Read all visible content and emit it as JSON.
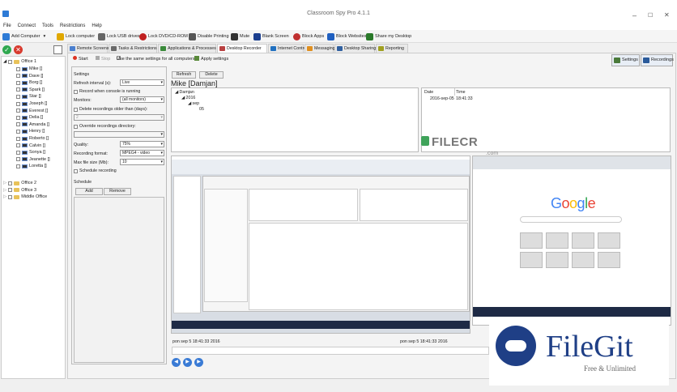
{
  "window": {
    "title": "Classroom Spy Pro 4.1.1",
    "minimize": "–",
    "maximize": "☐",
    "close": "✕"
  },
  "menu": [
    "File",
    "Connect",
    "Tools",
    "Restrictions",
    "Help"
  ],
  "toolbar": [
    {
      "label": "Add Computer",
      "icon": "add-computer-icon",
      "color": "#2e7bd6"
    },
    {
      "label": "Lock computer",
      "icon": "lock-icon",
      "color": "#e0a800"
    },
    {
      "label": "Lock USB drives",
      "icon": "usb-lock-icon",
      "color": "#666"
    },
    {
      "label": "Lock DVD/CD-ROM",
      "icon": "disc-lock-icon",
      "color": "#c02020"
    },
    {
      "label": "Disable Printing",
      "icon": "printer-icon",
      "color": "#555"
    },
    {
      "label": "Mute",
      "icon": "mute-icon",
      "color": "#333"
    },
    {
      "label": "Blank Screen",
      "icon": "blank-screen-icon",
      "color": "#1b3f8f"
    },
    {
      "label": "Block Apps",
      "icon": "block-apps-icon",
      "color": "#c03030"
    },
    {
      "label": "Block Websites",
      "icon": "block-websites-icon",
      "color": "#2060c0"
    },
    {
      "label": "Share my Desktop",
      "icon": "share-desktop-icon",
      "color": "#2a7a2a"
    }
  ],
  "tree": {
    "root": "Office 1",
    "computers": [
      "Mike []",
      "Dave []",
      "Borg []",
      "Spark []",
      "Star []",
      "Joseph []",
      "Everest []",
      "Delia []",
      "Amanda []",
      "Henry []",
      "Roberto []",
      "Calvin []",
      "Sonya []",
      "Jeanette []",
      "Loretta []"
    ],
    "groups": [
      "Office 2",
      "Office 3",
      "Middle Office"
    ]
  },
  "tabs": [
    {
      "label": "Remote Screens",
      "color": "#4a7fcf"
    },
    {
      "label": "Tasks & Restrictions",
      "color": "#6a6a6a"
    },
    {
      "label": "Applications & Processes",
      "color": "#3a8a3a"
    },
    {
      "label": "Desktop Recorder",
      "color": "#b84040"
    },
    {
      "label": "Internet Control",
      "color": "#2070c0"
    },
    {
      "label": "Messaging",
      "color": "#e09020"
    },
    {
      "label": "Desktop Sharing",
      "color": "#3060a0"
    },
    {
      "label": "Reporting",
      "color": "#a0a020"
    }
  ],
  "actions": {
    "start": "Start",
    "stop": "Stop",
    "same_settings": "Use the same settings for all computers",
    "apply": "Apply settings"
  },
  "right_buttons": {
    "settings": "Settings",
    "recordings": "Recordings"
  },
  "settings": {
    "heading": "Settings",
    "refresh_label": "Refresh interval (s):",
    "refresh_value": "Live",
    "record_console": "Record when console is running",
    "monitors_label": "Monitors:",
    "monitors_value": "(all monitors)",
    "delete_older": "Delete recordings older than (days):",
    "delete_value": "2",
    "override_dir": "Override recordings directory:",
    "quality_label": "Quality:",
    "quality_value": "75%",
    "format_label": "Recording format:",
    "format_value": "MPEG4 - video",
    "maxsize_label": "Max file size (Mb):",
    "maxsize_value": "10",
    "schedule_rec": "Schedule recording",
    "schedule_heading": "Schedule",
    "add": "Add",
    "remove": "Remove"
  },
  "recordings": {
    "refresh": "Refresh",
    "delete": "Delete",
    "user_heading": "Mike [Damjan]",
    "tree": [
      "Damjan",
      "2016",
      "sep",
      "05"
    ],
    "col_date": "Date",
    "col_time": "Time",
    "row_date": "2016-sep-05",
    "row_time": "18:41:33",
    "left_stamp": "pon sep 5 18:41:33 2016",
    "right_stamp": "pon sep 5 18:41:33 2016"
  },
  "browser": {
    "google": [
      "G",
      "o",
      "o",
      "g",
      "l",
      "e"
    ],
    "google_colors": [
      "#4285f4",
      "#ea4335",
      "#fbbc05",
      "#4285f4",
      "#34a853",
      "#ea4335"
    ]
  },
  "watermarks": {
    "filecr": "FILECR",
    "filecr_sub": ".com",
    "filegit": "FileGit",
    "filegit_sub": "Free & Unlimited"
  }
}
